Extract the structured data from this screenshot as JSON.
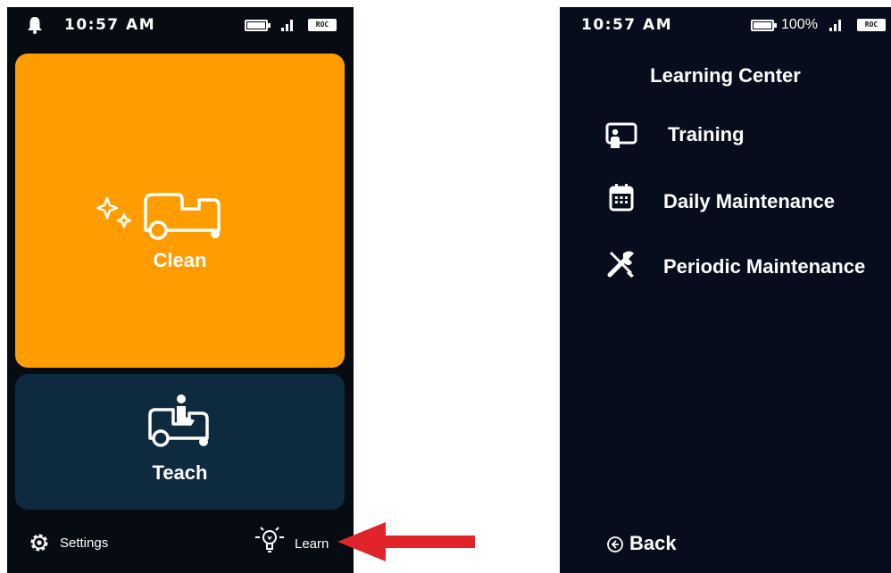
{
  "left_screen": {
    "status": {
      "time": "10:57 AM",
      "network": "ROC"
    },
    "tiles": [
      {
        "label": "Clean",
        "icon": "sparkle-vehicle-icon"
      },
      {
        "label": "Teach",
        "icon": "vehicle-operator-icon"
      }
    ],
    "bottom_nav": {
      "settings_label": "Settings",
      "learn_label": "Learn"
    }
  },
  "right_screen": {
    "status": {
      "time": "10:57 AM",
      "battery": "100%",
      "network": "ROC"
    },
    "title": "Learning Center",
    "menu": [
      {
        "label": "Training",
        "icon": "presentation-icon"
      },
      {
        "label": "Daily Maintenance",
        "icon": "calendar-icon"
      },
      {
        "label": "Periodic Maintenance",
        "icon": "tools-icon"
      }
    ],
    "back_label": "Back"
  },
  "colors": {
    "clean_tile": "#ff9d00",
    "teach_tile": "#0d2a3f",
    "screen_bg": "#070b12",
    "arrow": "#e0242a"
  }
}
